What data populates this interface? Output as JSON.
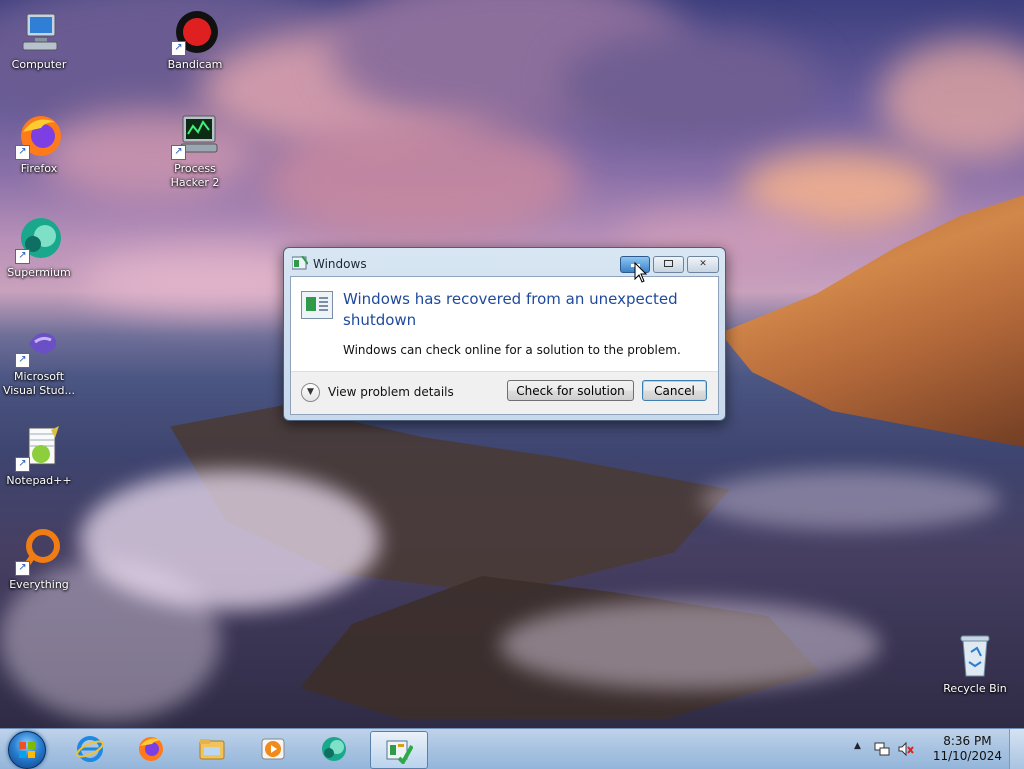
{
  "desktop": {
    "icons": [
      {
        "label": "Computer",
        "icon": "computer-icon"
      },
      {
        "label": "Bandicam",
        "icon": "bandicam-icon"
      },
      {
        "label": "Firefox",
        "icon": "firefox-icon"
      },
      {
        "label": "Process Hacker 2",
        "icon": "process-hacker-icon"
      },
      {
        "label": "Supermium",
        "icon": "supermium-icon"
      },
      {
        "label": "Microsoft Visual Stud...",
        "icon": "visual-studio-icon"
      },
      {
        "label": "Notepad++",
        "icon": "notepadpp-icon"
      },
      {
        "label": "Everything",
        "icon": "everything-icon"
      },
      {
        "label": "Recycle Bin",
        "icon": "recycle-bin-icon"
      }
    ]
  },
  "dialog": {
    "title": "Windows",
    "heading": "Windows has recovered from an unexpected shutdown",
    "message": "Windows can check online for a solution to the problem.",
    "details_label": "View problem details",
    "check_button": "Check for solution",
    "cancel_button": "Cancel",
    "caption_buttons": [
      "minimize",
      "restore",
      "close"
    ]
  },
  "taskbar": {
    "pinned": [
      "internet-explorer-icon",
      "firefox-icon",
      "file-explorer-icon",
      "media-player-icon",
      "supermium-icon",
      "problem-reports-icon"
    ],
    "active_index": 5,
    "clock_time": "8:36 PM",
    "clock_date": "11/10/2024",
    "tray": [
      "show-hidden-icons",
      "network-icon",
      "volume-muted-icon"
    ]
  },
  "colors": {
    "dialog_heading": "#1f4a9b",
    "taskbar": "#a9c4e2",
    "active_button_border": "#3c7fb1"
  }
}
